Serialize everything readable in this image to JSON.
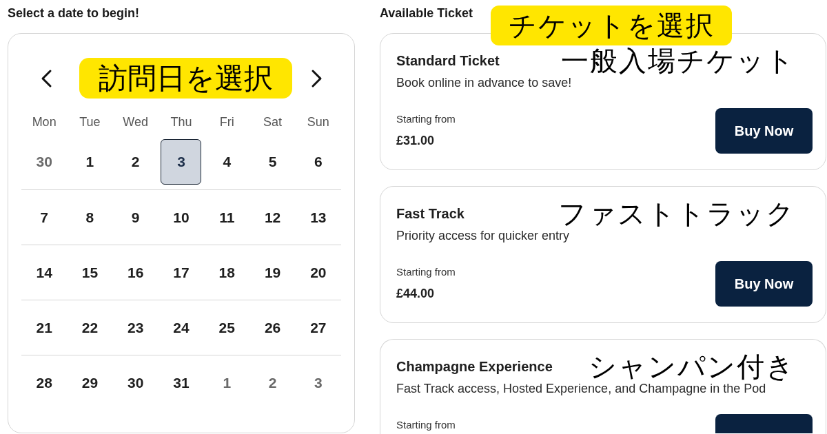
{
  "calendar": {
    "heading": "Select a date to begin!",
    "annotation": "訪問日を選択",
    "weekdays": [
      "Mon",
      "Tue",
      "Wed",
      "Thu",
      "Fri",
      "Sat",
      "Sun"
    ],
    "weeks": [
      [
        {
          "day": "30",
          "outside_month": true,
          "selected": false
        },
        {
          "day": "1",
          "outside_month": false,
          "selected": false
        },
        {
          "day": "2",
          "outside_month": false,
          "selected": false
        },
        {
          "day": "3",
          "outside_month": false,
          "selected": true
        },
        {
          "day": "4",
          "outside_month": false,
          "selected": false
        },
        {
          "day": "5",
          "outside_month": false,
          "selected": false
        },
        {
          "day": "6",
          "outside_month": false,
          "selected": false
        }
      ],
      [
        {
          "day": "7",
          "outside_month": false,
          "selected": false
        },
        {
          "day": "8",
          "outside_month": false,
          "selected": false
        },
        {
          "day": "9",
          "outside_month": false,
          "selected": false
        },
        {
          "day": "10",
          "outside_month": false,
          "selected": false
        },
        {
          "day": "11",
          "outside_month": false,
          "selected": false
        },
        {
          "day": "12",
          "outside_month": false,
          "selected": false
        },
        {
          "day": "13",
          "outside_month": false,
          "selected": false
        }
      ],
      [
        {
          "day": "14",
          "outside_month": false,
          "selected": false
        },
        {
          "day": "15",
          "outside_month": false,
          "selected": false
        },
        {
          "day": "16",
          "outside_month": false,
          "selected": false
        },
        {
          "day": "17",
          "outside_month": false,
          "selected": false
        },
        {
          "day": "18",
          "outside_month": false,
          "selected": false
        },
        {
          "day": "19",
          "outside_month": false,
          "selected": false
        },
        {
          "day": "20",
          "outside_month": false,
          "selected": false
        }
      ],
      [
        {
          "day": "21",
          "outside_month": false,
          "selected": false
        },
        {
          "day": "22",
          "outside_month": false,
          "selected": false
        },
        {
          "day": "23",
          "outside_month": false,
          "selected": false
        },
        {
          "day": "24",
          "outside_month": false,
          "selected": false
        },
        {
          "day": "25",
          "outside_month": false,
          "selected": false
        },
        {
          "day": "26",
          "outside_month": false,
          "selected": false
        },
        {
          "day": "27",
          "outside_month": false,
          "selected": false
        }
      ],
      [
        {
          "day": "28",
          "outside_month": false,
          "selected": false
        },
        {
          "day": "29",
          "outside_month": false,
          "selected": false
        },
        {
          "day": "30",
          "outside_month": false,
          "selected": false
        },
        {
          "day": "31",
          "outside_month": false,
          "selected": false
        },
        {
          "day": "1",
          "outside_month": true,
          "selected": false
        },
        {
          "day": "2",
          "outside_month": true,
          "selected": false
        },
        {
          "day": "3",
          "outside_month": true,
          "selected": false
        }
      ]
    ]
  },
  "tickets_panel": {
    "heading": "Available Ticket",
    "annotation": "チケットを選択",
    "tickets": [
      {
        "kind": "full",
        "name": "Standard Ticket",
        "annotation": "一般入場チケット",
        "description": "Book online in advance to save!",
        "price_label": "Starting from",
        "price": "£31.00",
        "button": "Buy Now"
      },
      {
        "kind": "full",
        "name": "Fast Track",
        "annotation": "ファストトラック",
        "description": "Priority access for quicker entry",
        "price_label": "Starting from",
        "price": "£44.00",
        "button": "Buy Now"
      },
      {
        "kind": "clipped",
        "name": "Champagne Experience",
        "annotation": "シャンパン付き",
        "description": "Fast Track access, Hosted Experience, and Champagne in the Pod",
        "price_label": "Starting from"
      }
    ]
  }
}
